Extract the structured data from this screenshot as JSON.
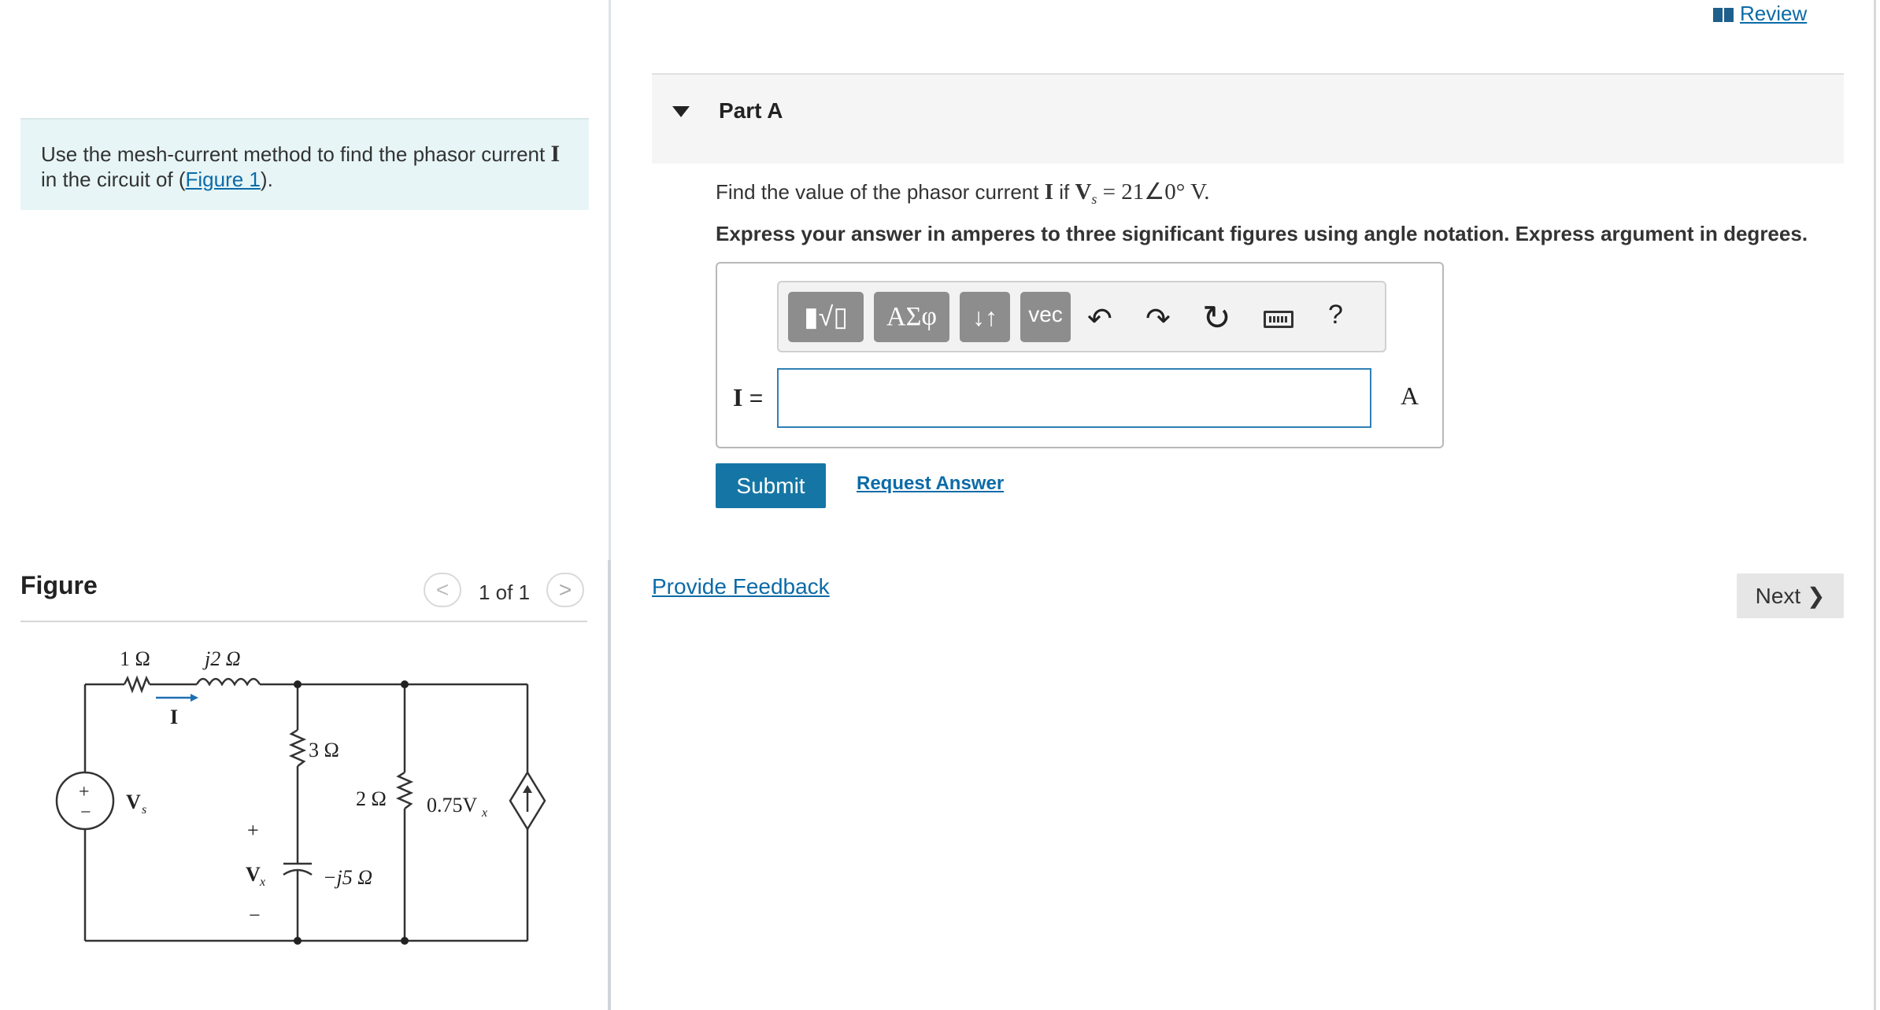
{
  "problem": {
    "text_before": "Use the mesh-current method to find the phasor current ",
    "symbol_I": "I",
    "text_mid": " in the circuit of (",
    "figure_link": "Figure 1",
    "text_end": ")."
  },
  "figure": {
    "title": "Figure",
    "prev_icon": "<",
    "counter": "1 of 1",
    "next_icon": ">",
    "circuit_labels": {
      "r1": "1 Ω",
      "l1": "j2 Ω",
      "current": "I",
      "source_plus": "+",
      "source_minus": "−",
      "vs": "V",
      "vs_sub": "s",
      "r3": "3 Ω",
      "vx_plus": "+",
      "vx": "V",
      "vx_sub": "x",
      "vx_minus": "−",
      "cap": "−j5 Ω",
      "r2": "2 Ω",
      "dep": "0.75V",
      "dep_sub": "x"
    }
  },
  "header": {
    "review_label": "Review"
  },
  "part": {
    "title": "Part A",
    "question_before": "Find the value of the phasor current ",
    "question_symbol": "I",
    "question_mid": " if ",
    "question_expr_V": "V",
    "question_expr_sub": "s",
    "question_expr_rest": " = 21∠0° V.",
    "instructions": "Express your answer in amperes to three significant figures using angle notation. Express argument in degrees."
  },
  "toolbar": {
    "template_icon": "▮√▯",
    "greek_label": "ΑΣφ",
    "arrows_label": "↓↑",
    "vec_label": "vec",
    "undo_icon": "↶",
    "redo_icon": "↷",
    "reset_icon": "↻",
    "help_label": "?"
  },
  "answer": {
    "label_symbol": "I",
    "label_eq": " =",
    "value": "",
    "unit": "A"
  },
  "actions": {
    "submit_label": "Submit",
    "request_answer_label": "Request Answer",
    "feedback_label": "Provide Feedback",
    "next_label": "Next ❯"
  },
  "colors": {
    "accent": "#1576a5",
    "link": "#0b6ba8",
    "problem_bg": "#e7f5f6",
    "toolbar_button": "#8d8d8d"
  }
}
